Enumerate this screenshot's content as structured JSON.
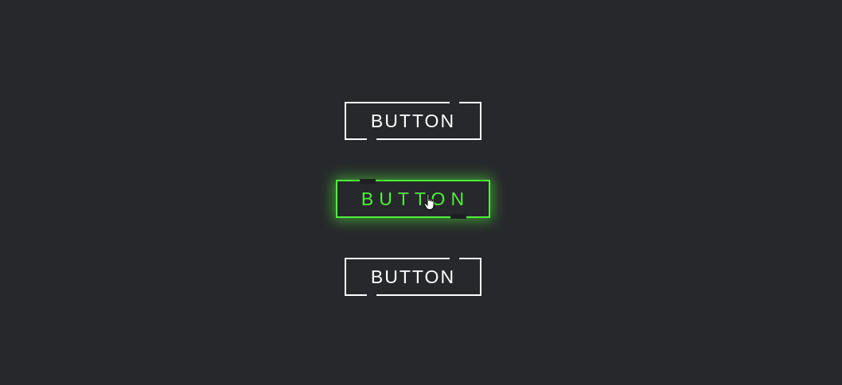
{
  "buttons": [
    {
      "label": "BUTTON",
      "state": "normal"
    },
    {
      "label": "BUTTON",
      "state": "hover"
    },
    {
      "label": "BUTTON",
      "state": "normal"
    }
  ],
  "colors": {
    "background": "#27282c",
    "normal_text": "#ffffff",
    "hover_accent": "#4ff03a"
  },
  "cursor": {
    "icon": "hand-pointer-icon"
  }
}
